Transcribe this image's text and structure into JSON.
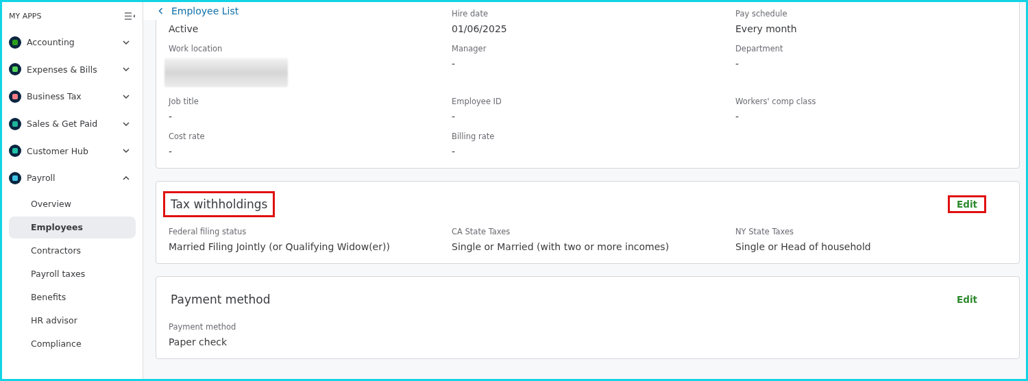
{
  "sidebar": {
    "heading": "MY APPS",
    "apps": [
      {
        "label": "Accounting",
        "expanded": false,
        "color": "#2ca01c"
      },
      {
        "label": "Expenses & Bills",
        "expanded": false,
        "color": "#53d35a"
      },
      {
        "label": "Business Tax",
        "expanded": false,
        "color": "#f87c86"
      },
      {
        "label": "Sales & Get Paid",
        "expanded": false,
        "color": "#1fb59a"
      },
      {
        "label": "Customer Hub",
        "expanded": false,
        "color": "#1fc4a8"
      },
      {
        "label": "Payroll",
        "expanded": true,
        "color": "#3fc4e8",
        "children": [
          {
            "label": "Overview",
            "selected": false
          },
          {
            "label": "Employees",
            "selected": true
          },
          {
            "label": "Contractors",
            "selected": false
          },
          {
            "label": "Payroll taxes",
            "selected": false
          },
          {
            "label": "Benefits",
            "selected": false
          },
          {
            "label": "HR advisor",
            "selected": false
          },
          {
            "label": "Compliance",
            "selected": false
          }
        ]
      }
    ]
  },
  "back_link": {
    "label": "Employee List"
  },
  "sections": [
    {
      "status": "Active",
      "fields": [
        {
          "kind": "text",
          "label": "Hire date",
          "value": "01/06/2025"
        },
        {
          "kind": "text",
          "label": "Pay schedule",
          "value": "Every month"
        },
        {
          "kind": "blurred",
          "label": "Work location"
        },
        {
          "kind": "text",
          "label": "Manager",
          "value": "-"
        },
        {
          "kind": "text",
          "label": "Department",
          "value": "-"
        },
        {
          "kind": "text",
          "label": "Job title",
          "value": "-"
        },
        {
          "kind": "text",
          "label": "Employee ID",
          "value": "-"
        },
        {
          "kind": "text",
          "label": "Workers' comp class",
          "value": "-"
        },
        {
          "kind": "text",
          "label": "Cost rate",
          "value": "-"
        },
        {
          "kind": "text",
          "label": "Billing rate",
          "value": "-"
        }
      ]
    },
    {
      "title": "Tax withholdings",
      "highlighted": true,
      "edit": {
        "label": "Edit",
        "highlighted": true
      },
      "fields": [
        {
          "kind": "text",
          "label": "Federal filing status",
          "value": "Married Filing Jointly (or Qualifying Widow(er))"
        },
        {
          "kind": "text",
          "label": "CA State Taxes",
          "value": "Single or Married (with two or more incomes)"
        },
        {
          "kind": "text",
          "label": "NY State Taxes",
          "value": "Single or Head of household"
        }
      ]
    },
    {
      "title": "Payment method",
      "highlighted": false,
      "edit": {
        "label": "Edit",
        "highlighted": false
      },
      "fields": [
        {
          "kind": "text",
          "label": "Payment method",
          "value": "Paper check"
        }
      ]
    }
  ]
}
